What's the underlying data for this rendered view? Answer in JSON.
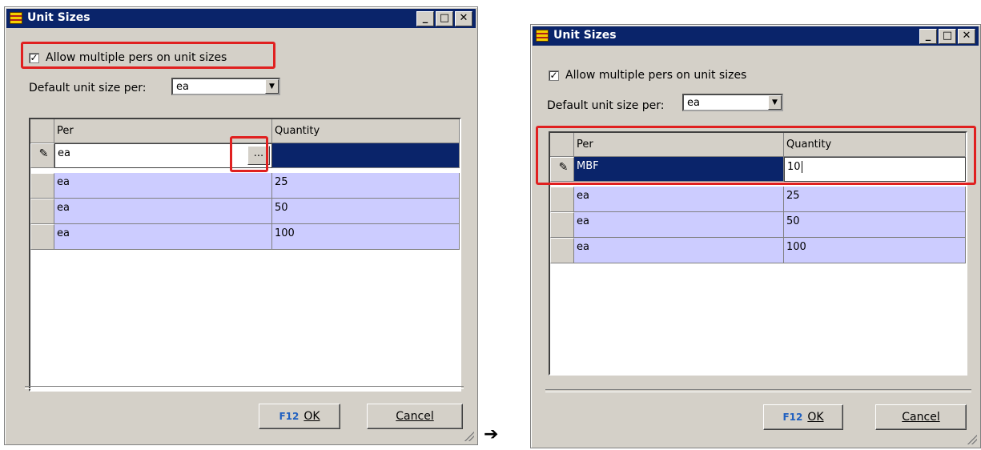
{
  "left": {
    "title": "Unit Sizes",
    "checkbox_label": "Allow multiple pers on unit sizes",
    "default_label": "Default unit size per:",
    "combo_value": "ea",
    "col_per": "Per",
    "col_quantity": "Quantity",
    "edit_row": {
      "per": "ea",
      "quantity": "",
      "ellipsis": "..."
    },
    "rows": [
      {
        "per": "ea",
        "quantity": "25"
      },
      {
        "per": "ea",
        "quantity": "50"
      },
      {
        "per": "ea",
        "quantity": "100"
      }
    ],
    "ok_prefix": "F12",
    "ok_label": "OK",
    "cancel_label": "Cancel"
  },
  "right": {
    "title": "Unit Sizes",
    "checkbox_label": "Allow multiple pers on unit sizes",
    "default_label": "Default unit size per:",
    "combo_value": "ea",
    "col_per": "Per",
    "col_quantity": "Quantity",
    "edit_row": {
      "per": "MBF",
      "quantity": "10"
    },
    "rows": [
      {
        "per": "ea",
        "quantity": "25"
      },
      {
        "per": "ea",
        "quantity": "50"
      },
      {
        "per": "ea",
        "quantity": "100"
      }
    ],
    "ok_prefix": "F12",
    "ok_label": "OK",
    "cancel_label": "Cancel"
  },
  "arrow": "➔",
  "icons": {
    "minimize": "minimize-icon",
    "maximize": "maximize-icon",
    "close": "close-icon",
    "pencil": "pencil-icon"
  },
  "colors": {
    "titlebar": "#0a246a",
    "row_bg": "#ccccff",
    "highlight": "#e02020"
  }
}
